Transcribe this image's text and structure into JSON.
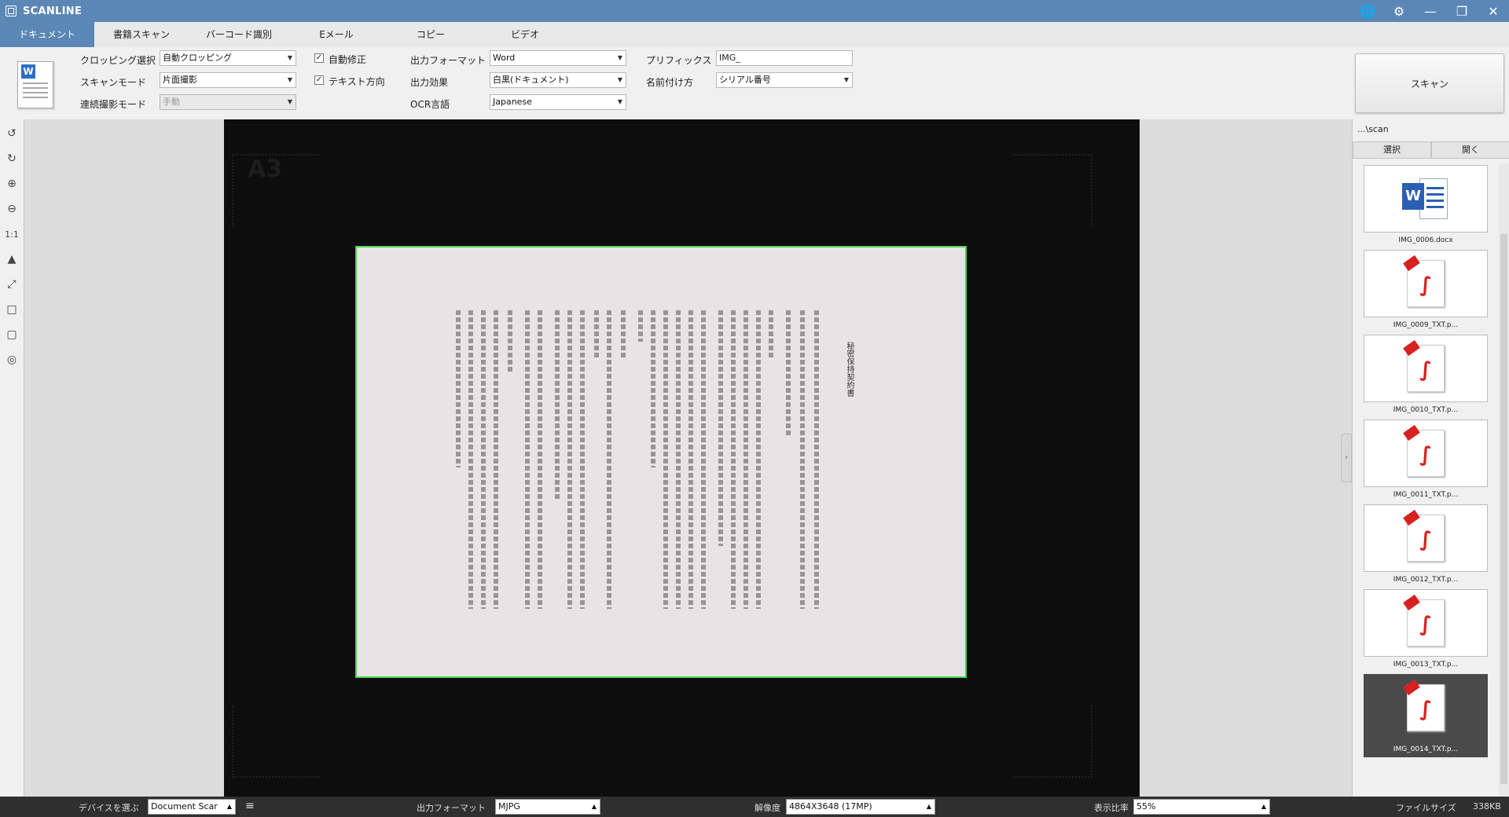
{
  "app": {
    "title": "SCANLINE"
  },
  "window_icons": [
    "globe-icon",
    "gear-icon",
    "minimize-icon",
    "restore-icon",
    "close-icon"
  ],
  "menu": {
    "tabs": [
      {
        "label": "ドキュメント",
        "active": true
      },
      {
        "label": "書籍スキャン"
      },
      {
        "label": "バーコード識別"
      },
      {
        "label": "Eメール"
      },
      {
        "label": "コピー"
      },
      {
        "label": "ビデオ"
      }
    ]
  },
  "ribbon": {
    "crop_label": "クロッピング選択",
    "crop_value": "自動クロッピング",
    "scanmode_label": "スキャンモード",
    "scanmode_value": "片面撮影",
    "continuous_label": "連続撮影モード",
    "continuous_value": "手動",
    "autocorrect_label": "自動修正",
    "autocorrect_checked": true,
    "textdir_label": "テキスト方向",
    "textdir_checked": true,
    "format_label": "出力フォーマット",
    "format_value": "Word",
    "effect_label": "出力効果",
    "effect_value": "白黒(ドキュメント)",
    "ocr_label": "OCR言語",
    "ocr_value": "Japanese",
    "prefix_label": "プリフィックス",
    "prefix_value": "IMG_",
    "naming_label": "名前付け方",
    "naming_value": "シリアル番号",
    "scan_button": "スキャン"
  },
  "viewer": {
    "paper_size_label": "A3",
    "document_title": "秘密保持契約書"
  },
  "right_panel": {
    "path": "...\\scan",
    "select_button": "選択",
    "open_button": "開く",
    "files": [
      {
        "name": "IMG_0006.docx",
        "type": "word"
      },
      {
        "name": "IMG_0009_TXT.p...",
        "type": "pdf"
      },
      {
        "name": "IMG_0010_TXT.p...",
        "type": "pdf"
      },
      {
        "name": "IMG_0011_TXT.p...",
        "type": "pdf"
      },
      {
        "name": "IMG_0012_TXT.p...",
        "type": "pdf"
      },
      {
        "name": "IMG_0013_TXT.p...",
        "type": "pdf"
      },
      {
        "name": "IMG_0014_TXT.p...",
        "type": "pdf",
        "selected": true
      }
    ]
  },
  "statusbar": {
    "device_label": "デバイスを選ぶ",
    "device_value": "Document Scar",
    "format_label": "出力フォーマット",
    "format_value": "MJPG",
    "resolution_label": "解像度",
    "resolution_value": "4864X3648 (17MP)",
    "zoom_label": "表示比率",
    "zoom_value": "55%",
    "filesize_label": "ファイルサイズ",
    "filesize_value": "338KB"
  }
}
